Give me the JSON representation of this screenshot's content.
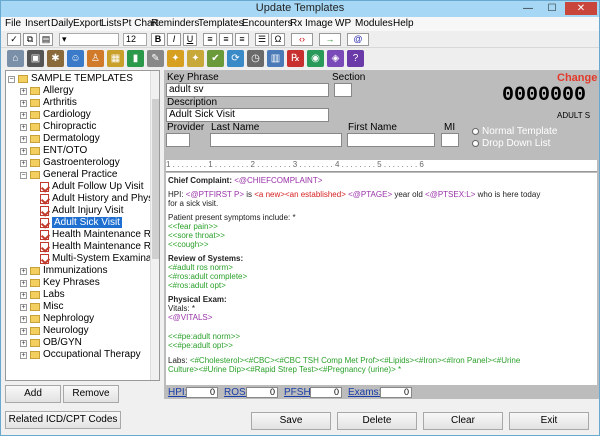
{
  "window": {
    "title": "Update Templates",
    "min": "—",
    "max": "☐",
    "close": "✕"
  },
  "menu": [
    "File",
    "Insert",
    "Daily",
    "Export",
    "Lists",
    "Pt Chart",
    "Reminders",
    "Templates",
    "Encounters",
    "Rx",
    "Image",
    "WP",
    "Modules",
    "Help"
  ],
  "toolbar": {
    "font_size": "12",
    "bold": "B",
    "italic": "I",
    "underline": "U",
    "omega": "Ω"
  },
  "tree": {
    "root": "SAMPLE TEMPLATES",
    "items": [
      {
        "label": "Allergy",
        "type": "folder",
        "expander": "+"
      },
      {
        "label": "Arthritis",
        "type": "folder",
        "expander": "+"
      },
      {
        "label": "Cardiology",
        "type": "folder",
        "expander": "+"
      },
      {
        "label": "Chiropractic",
        "type": "folder",
        "expander": "+"
      },
      {
        "label": "Dermatology",
        "type": "folder",
        "expander": "+"
      },
      {
        "label": "ENT/OTO",
        "type": "folder",
        "expander": "+"
      },
      {
        "label": "Gastroenterology",
        "type": "folder",
        "expander": "+"
      },
      {
        "label": "General Practice",
        "type": "folder",
        "expander": "−"
      },
      {
        "label": "Adult Follow Up Visit",
        "type": "doc"
      },
      {
        "label": "Adult History and Phys",
        "type": "doc"
      },
      {
        "label": "Adult Injury Visit",
        "type": "doc"
      },
      {
        "label": "Adult Sick Visit",
        "type": "doc",
        "selected": true
      },
      {
        "label": "Health Maintenance Re",
        "type": "doc"
      },
      {
        "label": "Health Maintenance Re",
        "type": "doc"
      },
      {
        "label": "Multi-System Examinat",
        "type": "doc"
      },
      {
        "label": "Immunizations",
        "type": "folder",
        "expander": "+"
      },
      {
        "label": "Key Phrases",
        "type": "folder",
        "expander": "+"
      },
      {
        "label": "Labs",
        "type": "folder",
        "expander": "+"
      },
      {
        "label": "Misc",
        "type": "folder",
        "expander": "+"
      },
      {
        "label": "Nephrology",
        "type": "folder",
        "expander": "+"
      },
      {
        "label": "Neurology",
        "type": "folder",
        "expander": "+"
      },
      {
        "label": "OB/GYN",
        "type": "folder",
        "expander": "+"
      },
      {
        "label": "Occupational Therapy",
        "type": "folder",
        "expander": "+"
      }
    ]
  },
  "buttons": {
    "add": "Add",
    "remove": "Remove",
    "related": "Related ICD/CPT Codes",
    "save": "Save",
    "delete": "Delete",
    "clear": "Clear",
    "exit": "Exit"
  },
  "form": {
    "key_phrase_label": "Key Phrase",
    "key_phrase_value": "adult sv",
    "section_label": "Section",
    "description_label": "Description",
    "description_value": "Adult Sick Visit",
    "provider_label": "Provider",
    "lastname_label": "Last Name",
    "firstname_label": "First Name",
    "mi_label": "MI",
    "change_label": "Change",
    "big_number": "0000000",
    "adult_s": "ADULT S",
    "normal_template": "Normal Template",
    "drop_down_list": "Drop Down List"
  },
  "editor": {
    "chief_label": "Chief Complaint:",
    "chief_tag": "<@CHIEFCOMPLAINT>",
    "hpi_label": "HPI:",
    "hpi_tag1": "<@PTFIRST P>",
    "hpi_is": " is ",
    "hpi_tag2": "<a new><an established>",
    "hpi_tag3": "<@PTAGE>",
    "hpi_yearold": " year old ",
    "hpi_tag4": "<@PTSEX:L>",
    "hpi_rest": " who is here today",
    "hpi_line2": "for a sick visit.",
    "symptoms": "Patient present symptoms include: *",
    "sym1": "<<fear pain>>",
    "sym2": "<<sore throat>>",
    "sym3": "<<cough>>",
    "ros_head": "Review of Systems:",
    "ros1": "<#adult ros norm>",
    "ros2": "<#ros:adult complete>",
    "ros3": "<#ros:adult opt>",
    "pe_head": "Physical Exam:",
    "vitals": "Vitals: *",
    "vitals_tag": "<@VITALS>",
    "pe1": "<<#pe:adult norm>>",
    "pe2": "<<#pe:adult opt>>",
    "labs_label": "Labs:",
    "labs_line1": "<#Cholesterol><#CBC><#CBC TSH Comp Met Prof><#Lipids><#Iron><#Iron Panel><#Urine",
    "labs_line2": "Culture><#Urine Dip><#Rapid Strep Test><#Pregnancy (urine)> *"
  },
  "status": {
    "hpi_label": "HPI:",
    "hpi_value": "0",
    "ros_label": "ROS:",
    "ros_value": "0",
    "pfsh_label": "PFSH:",
    "pfsh_value": "0",
    "exams_label": "Exams:",
    "exams_value": "0"
  },
  "ruler_text": "1 . . . . . . . . 1 . . . . . . . . 2 . . . . . . . . 3 . . . . . . . . 4 . . . . . . . . 5 . . . . . . . . 6"
}
